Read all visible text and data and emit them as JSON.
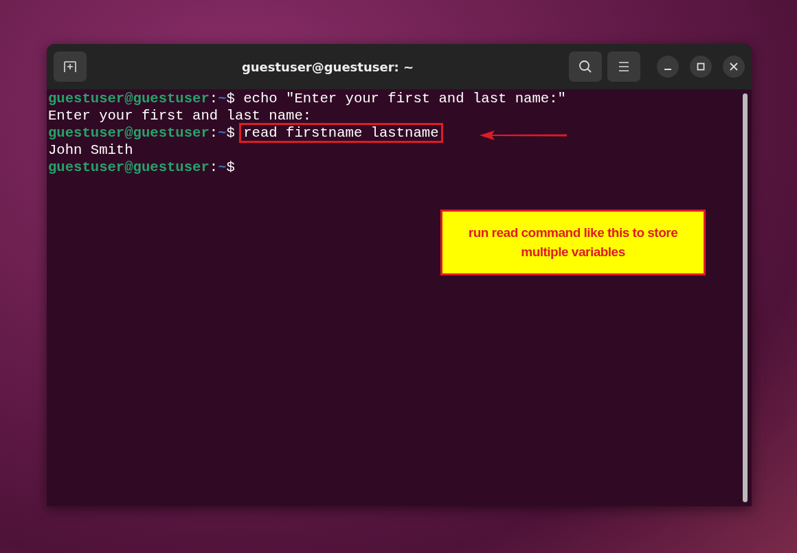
{
  "window": {
    "title": "guestuser@guestuser: ~"
  },
  "lines": [
    {
      "kind": "prompt",
      "user": "guestuser@guestuser",
      "separator": ":",
      "path": "~",
      "symbol": "$",
      "command": "echo \"Enter your first and last name:\"",
      "highlighted": false
    },
    {
      "kind": "output",
      "text": "Enter your first and last name:"
    },
    {
      "kind": "prompt",
      "user": "guestuser@guestuser",
      "separator": ":",
      "path": "~",
      "symbol": "$",
      "command": "read firstname lastname",
      "highlighted": true
    },
    {
      "kind": "output",
      "text": "John Smith"
    },
    {
      "kind": "prompt",
      "user": "guestuser@guestuser",
      "separator": ":",
      "path": "~",
      "symbol": "$"
    }
  ],
  "callout": {
    "text": "run read command like this to store multiple variables"
  }
}
